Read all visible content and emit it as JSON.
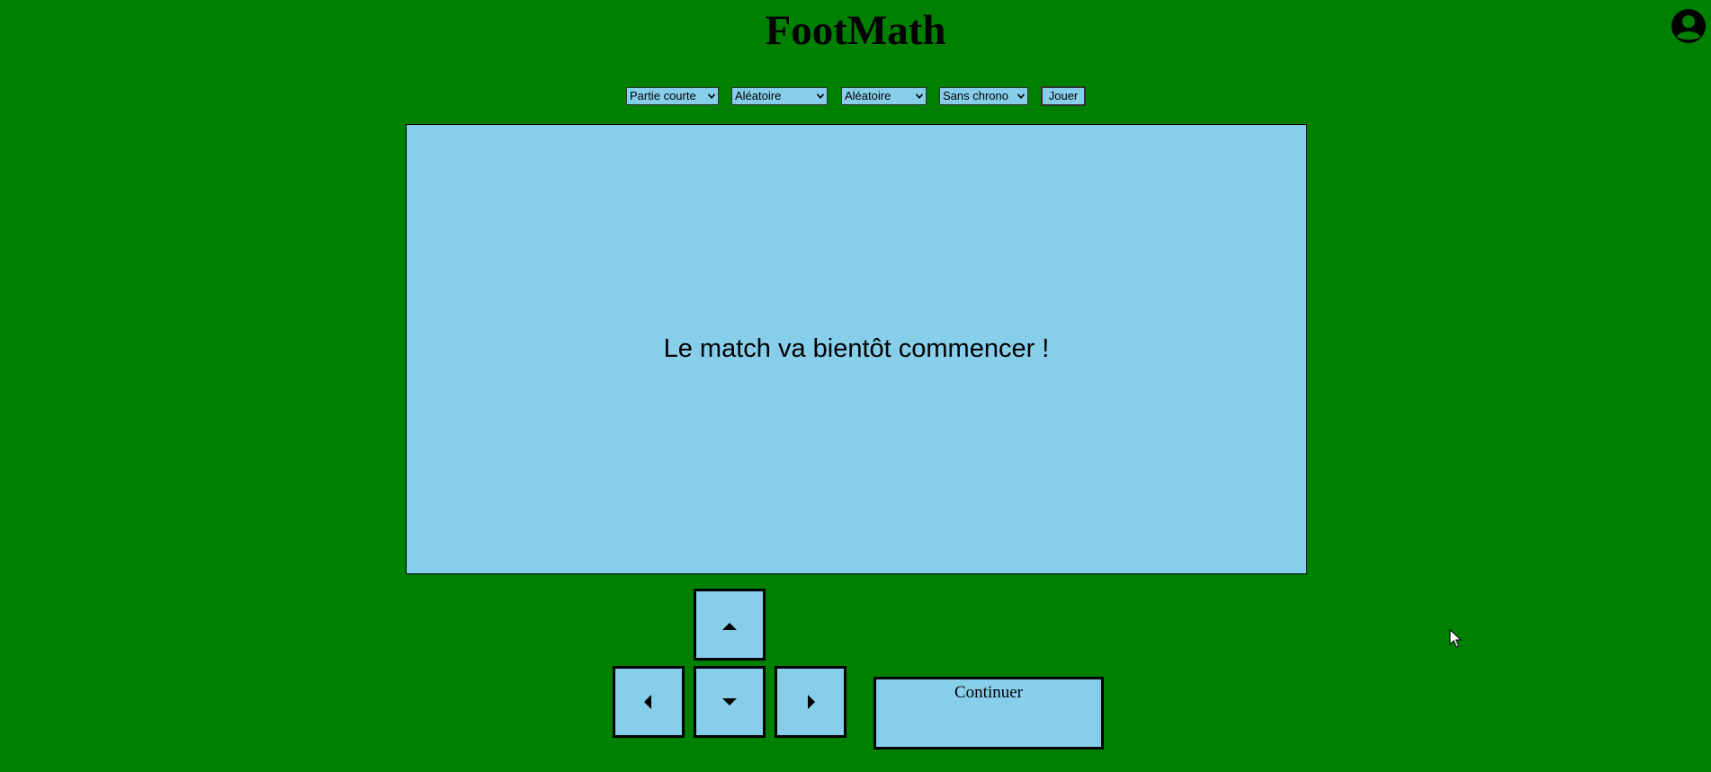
{
  "app": {
    "title": "FootMath"
  },
  "settings": {
    "game_length": "Partie courte",
    "option_2": "Aléatoire",
    "option_3": "Aléatoire",
    "timer": "Sans chrono",
    "play_label": "Jouer"
  },
  "board": {
    "message": "Le match va bientôt commencer !"
  },
  "controls": {
    "continue_label": "Continuer"
  },
  "icons": {
    "account": "account-circle-icon",
    "up": "arrow-up-icon",
    "down": "arrow-down-icon",
    "left": "arrow-left-icon",
    "right": "arrow-right-icon"
  },
  "colors": {
    "background": "#008000",
    "panel": "#87ceeb",
    "border": "#000000"
  }
}
